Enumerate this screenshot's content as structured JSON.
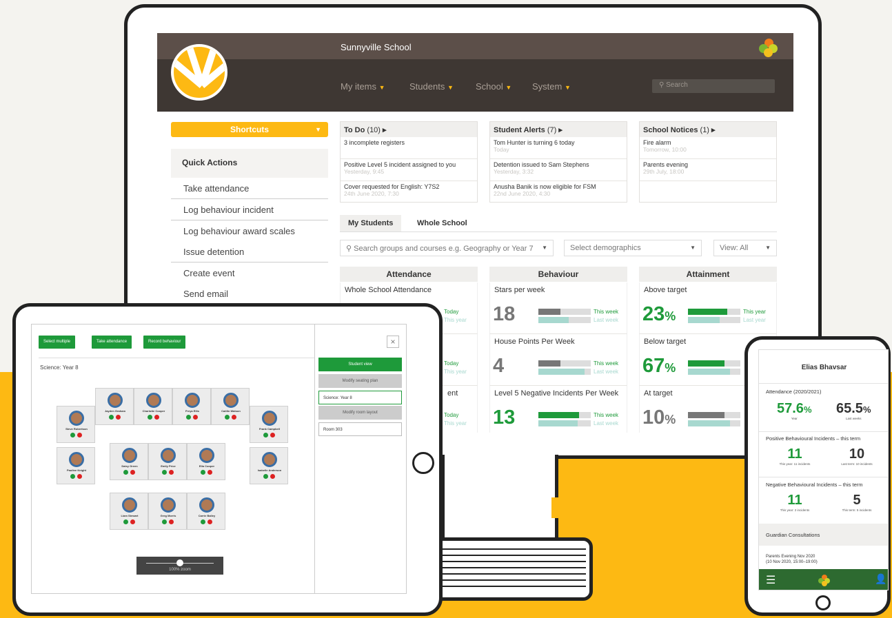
{
  "desktop": {
    "school_name": "Sunnyville School",
    "nav": [
      "My items",
      "Students",
      "School",
      "System"
    ],
    "search_placeholder": "Search",
    "shortcuts_label": "Shortcuts",
    "quick_actions_title": "Quick Actions",
    "quick_actions": [
      "Take attendance",
      "Log behaviour incident",
      "Log behaviour award scales",
      "Issue detention",
      "Create event",
      "Send email"
    ],
    "todo": {
      "title": "To Do",
      "count": "(10)",
      "items": [
        {
          "text": "3 incomplete registers",
          "meta": ""
        },
        {
          "text": "Positive Level 5 incident assigned to you",
          "meta": "Yesterday, 9:45"
        },
        {
          "text": "Cover requested for English: Y7S2",
          "meta": "24th June 2020, 7:30"
        }
      ]
    },
    "alerts": {
      "title": "Student Alerts",
      "count": "(7)",
      "items": [
        {
          "text": "Tom Hunter is turning 6 today",
          "meta": "Today"
        },
        {
          "text": "Detention issued to Sam Stephens",
          "meta": "Yesterday, 3:32"
        },
        {
          "text": "Anusha Banik is now eligible for FSM",
          "meta": "22nd June 2020, 4:30"
        }
      ]
    },
    "notices": {
      "title": "School Notices",
      "count": "(1)",
      "items": [
        {
          "text": "Fire alarm",
          "meta": "Tomorrow, 10:00"
        },
        {
          "text": "Parents evening",
          "meta": "29th July, 18:00"
        }
      ]
    },
    "tabs": [
      "My Students",
      "Whole School"
    ],
    "filter_search": "Search groups and courses e.g. Geography or Year 7",
    "filter_demo": "Select demographics",
    "filter_view": "View: All",
    "columns": [
      "Attendance",
      "Behaviour",
      "Attainment"
    ],
    "attendance": [
      {
        "title": "Whole School Attendance",
        "today": "Today",
        "year": "This year"
      },
      {
        "title": "",
        "today": "Today",
        "year": "This year"
      },
      {
        "title": "ent",
        "today": "Today",
        "year": "This year"
      }
    ],
    "behaviour": [
      {
        "title": "Stars per week",
        "value": "18",
        "tw": "This week",
        "lw": "Last week",
        "bar_this": 0.42,
        "bar_last": 0.58
      },
      {
        "title": "House Points Per Week",
        "value": "4",
        "tw": "This week",
        "lw": "Last week",
        "bar_this": 0.42,
        "bar_last": 0.88
      },
      {
        "title": "Level 5 Negative Incidents Per Week",
        "value": "13",
        "tw": "This week",
        "lw": "Last week",
        "bar_this": 0.77,
        "bar_last": 0.75
      }
    ],
    "attainment": [
      {
        "title": "Above target",
        "value": "23",
        "unit": "%",
        "ty": "This year",
        "ly": "Last year",
        "bar_this": 0.75,
        "bar_last": 0.6
      },
      {
        "title": "Below target",
        "value": "67",
        "unit": "%",
        "bar_this": 0.7,
        "bar_last": 0.8
      },
      {
        "title": "At target",
        "value": "10",
        "unit": "%",
        "bar_this": 0.7,
        "bar_last": 0.8
      }
    ]
  },
  "tablet": {
    "buttons": [
      "Select multiple",
      "Take attendance",
      "Record behaviour"
    ],
    "class_label": "Science: Year 8",
    "side": [
      "Student view",
      "Modify seating plan",
      "Science: Year 8",
      "Modify room layout",
      "Room 303"
    ],
    "zoom_label": "100% zoom",
    "students": [
      "Jayden Graham",
      "Charlotte Cooper",
      "Freya Ellis",
      "Caitlin Watson",
      "Steve Robertson",
      "Frank Campbell",
      "Pauline Knight",
      "Daisy Green",
      "Emily Price",
      "Ella Cooper",
      "Isabelle Anderson",
      "Liam Stewart",
      "Greg Morris",
      "Carrie Bailey"
    ]
  },
  "phone": {
    "name": "Elias Bhavsar",
    "attendance_label": "Attendance (2020/2021)",
    "att_year": "57.6",
    "att_year_unit": "%",
    "att_year_lbl": "Year",
    "att_last": "65.5",
    "att_last_unit": "%",
    "att_last_lbl": "Last weeks",
    "pos_label": "Positive Behavioural Incidents – this term",
    "pos_a": "11",
    "pos_a_lbl": "This year: 11 incidents",
    "pos_b": "10",
    "pos_b_lbl": "Last term: 10 incidents",
    "neg_label": "Negative Behavioural Incidents – this term",
    "neg_a": "11",
    "neg_a_lbl": "This year: 2 incidents",
    "neg_b": "5",
    "neg_b_lbl": "This term: 5 incidents",
    "guardian_label": "Guardian Consultations",
    "event_title": "Parents Evening Nov 2020",
    "event_time": "(10 Nov 2020, 15:00–19:00)"
  },
  "colors": {
    "yellow": "#fdb913",
    "green": "#1e9a3a",
    "teal": "#a7d8cf",
    "grey_bar": "#777777",
    "dark_nav": "#3e3733"
  }
}
